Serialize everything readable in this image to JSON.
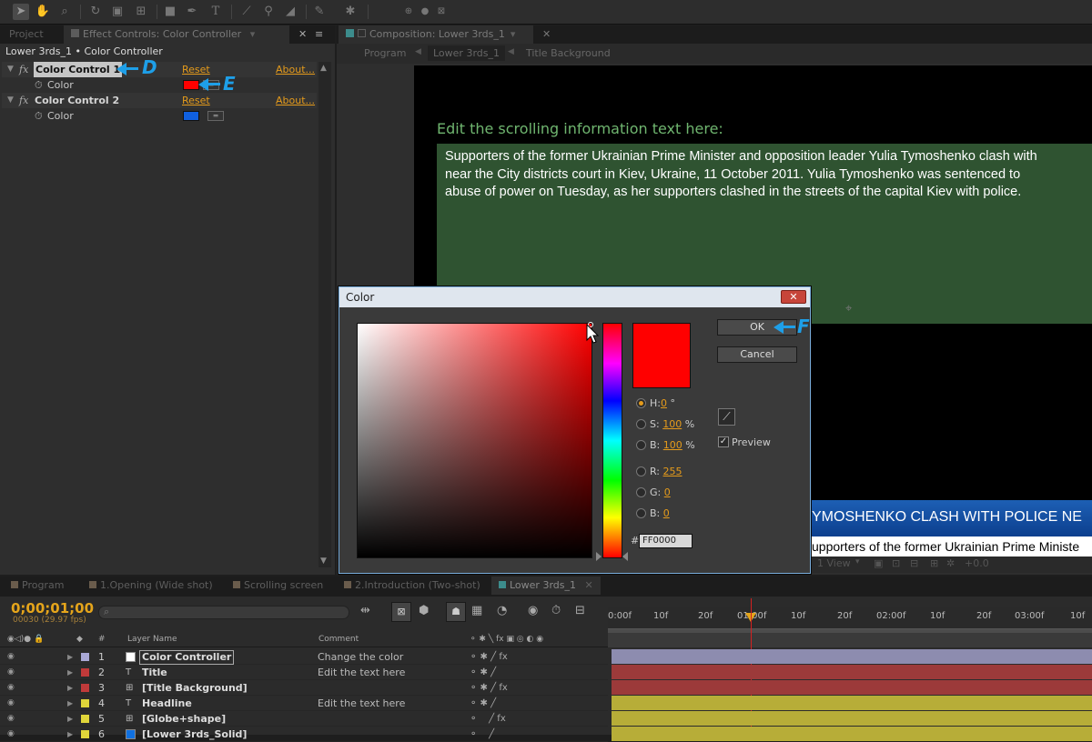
{
  "colors": {
    "accent": "#e59b1b",
    "annotation": "#1e9fe8",
    "selected": "#ff0000",
    "green_bg": "#2f5331"
  },
  "toolbar": {
    "icons": [
      "selection-tool-icon",
      "hand-tool-icon",
      "zoom-tool-icon",
      "rotate-tool-icon",
      "camera-tool-icon",
      "pan-behind-tool-icon",
      "rectangle-tool-icon",
      "pen-tool-icon",
      "type-tool-icon",
      "brush-tool-icon",
      "clone-stamp-tool-icon",
      "eraser-tool-icon",
      "roto-brush-tool-icon",
      "puppet-tool-icon"
    ]
  },
  "left_panel": {
    "tabs": [
      {
        "label": "Project"
      },
      {
        "label": "Effect Controls: Color Controller"
      }
    ],
    "breadcrumb": "Lower 3rds_1 • Color Controller",
    "effects": [
      {
        "name": "Color Control 1",
        "reset": "Reset",
        "about": "About...",
        "prop": "Color",
        "color": "#ff0000"
      },
      {
        "name": "Color Control 2",
        "reset": "Reset",
        "about": "About...",
        "prop": "Color",
        "color": "#1060e0"
      }
    ],
    "annotations": {
      "d": "D",
      "e": "E"
    }
  },
  "comp_panel": {
    "tab": "Composition: Lower 3rds_1",
    "breadcrumbs": [
      "Program",
      "Lower 3rds_1",
      "Title Background"
    ],
    "heading": "Edit the scrolling information text here:",
    "body": "Supporters of the former Ukrainian Prime Minister and opposition leader Yulia Tymoshenko clash with\nnear the City districts court in Kiev, Ukraine, 11 October 2011. Yulia Tymoshenko was sentenced to\nabuse of power on Tuesday, as her supporters clashed in the streets of the capital Kiev with police.",
    "ticker_headline": "YMOSHENKO CLASH WITH POLICE NE",
    "ticker_text": "upporters of the former Ukrainian Prime Ministe",
    "bottom_bar": {
      "view": "1 View",
      "offset": "+0.0"
    }
  },
  "dialog": {
    "title": "Color",
    "close": "✕",
    "ok": "OK",
    "cancel": "Cancel",
    "annotation": "F",
    "fields": [
      {
        "label": "H:",
        "value": "0",
        "unit": "°",
        "selected": true
      },
      {
        "label": "S:",
        "value": "100",
        "unit": "%",
        "selected": false
      },
      {
        "label": "B:",
        "value": "100",
        "unit": "%",
        "selected": false
      },
      {
        "label": "R:",
        "value": "255",
        "unit": "",
        "selected": false
      },
      {
        "label": "G:",
        "value": "0",
        "unit": "",
        "selected": false
      },
      {
        "label": "B:",
        "value": "0",
        "unit": "",
        "selected": false
      }
    ],
    "preview_label": "Preview",
    "hash": "#",
    "hex": "FF0000"
  },
  "timeline": {
    "tabs": [
      {
        "label": "Program"
      },
      {
        "label": "1.Opening (Wide shot)"
      },
      {
        "label": "Scrolling screen"
      },
      {
        "label": "2.Introduction (Two-shot)"
      },
      {
        "label": "Lower 3rds_1"
      }
    ],
    "timecode": "0;00;01;00",
    "frames": "00030 (29.97 fps)",
    "col_num": "#",
    "col_name": "Layer Name",
    "col_comment": "Comment",
    "ruler": [
      "0:00f",
      "10f",
      "20f",
      "01:00f",
      "10f",
      "20f",
      "02:00f",
      "10f",
      "20f",
      "03:00f",
      "10f"
    ],
    "layers": [
      {
        "num": "1",
        "name": "Color Controller",
        "comment": "Change the color",
        "label_color": "#a9a8d6",
        "bar_color": "#8d8caf",
        "type": "solid-white"
      },
      {
        "num": "2",
        "name": "Title",
        "comment": "Edit the text here",
        "label_color": "#c03a3a",
        "bar_color": "#9c3a3a",
        "type": "text"
      },
      {
        "num": "3",
        "name": "[Title Background]",
        "comment": "",
        "label_color": "#c03a3a",
        "bar_color": "#9c3a3a",
        "type": "comp"
      },
      {
        "num": "4",
        "name": "Headline",
        "comment": "Edit the text here",
        "label_color": "#e0d53a",
        "bar_color": "#b7ad38",
        "type": "text"
      },
      {
        "num": "5",
        "name": "[Globe+shape]",
        "comment": "",
        "label_color": "#e0d53a",
        "bar_color": "#b7ad38",
        "type": "comp"
      },
      {
        "num": "6",
        "name": "[Lower 3rds_Solid]",
        "comment": "",
        "label_color": "#e0d53a",
        "bar_color": "#b7ad38",
        "type": "solid-blue"
      }
    ]
  }
}
